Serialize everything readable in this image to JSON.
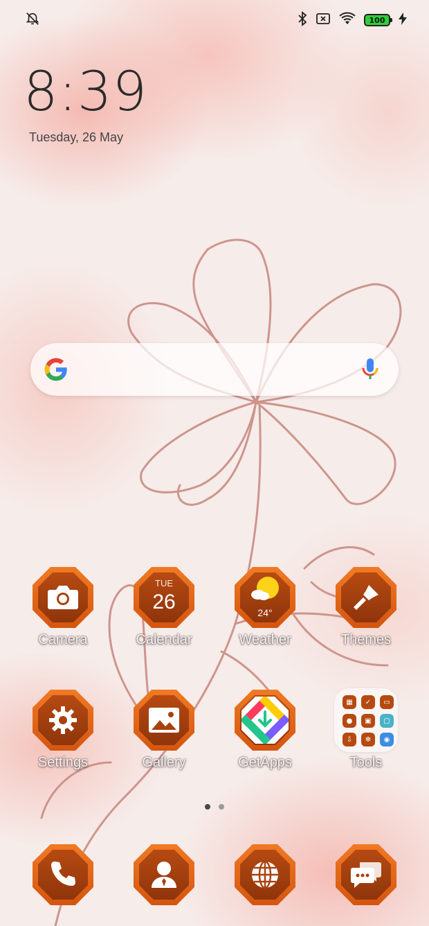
{
  "status_bar": {
    "left_icon": "silent-alarm-icon",
    "right_icons": [
      "bluetooth-icon",
      "no-sim-icon",
      "wifi-icon"
    ],
    "battery_level": "100",
    "charging_icon": "bolt-icon",
    "battery_color": "#2fce3a"
  },
  "clock": {
    "time": "8:39",
    "date": "Tuesday, 26 May"
  },
  "search": {
    "logo": "google-g-icon",
    "mic": "mic-icon"
  },
  "apps_row1": [
    {
      "label": "Camera",
      "icon": "camera-icon"
    },
    {
      "label": "Calendar",
      "icon": "calendar-icon",
      "day": "TUE",
      "date": "26"
    },
    {
      "label": "Weather",
      "icon": "weather-sun-icon",
      "temp": "24°"
    },
    {
      "label": "Themes",
      "icon": "paintbrush-icon"
    }
  ],
  "apps_row2": [
    {
      "label": "Settings",
      "icon": "gear-icon"
    },
    {
      "label": "Gallery",
      "icon": "image-icon"
    },
    {
      "label": "GetApps",
      "icon": "getapps-icon"
    },
    {
      "label": "Tools",
      "icon": "folder-icon"
    }
  ],
  "dock": [
    {
      "icon": "phone-icon"
    },
    {
      "icon": "contacts-icon"
    },
    {
      "icon": "globe-icon"
    },
    {
      "icon": "messages-icon"
    }
  ],
  "page_indicator": {
    "pages": 2,
    "current": 1
  },
  "colors": {
    "icon_outer": "#e3661b",
    "icon_inner": "#a9420f",
    "wallpaper": "#f6ecea"
  }
}
